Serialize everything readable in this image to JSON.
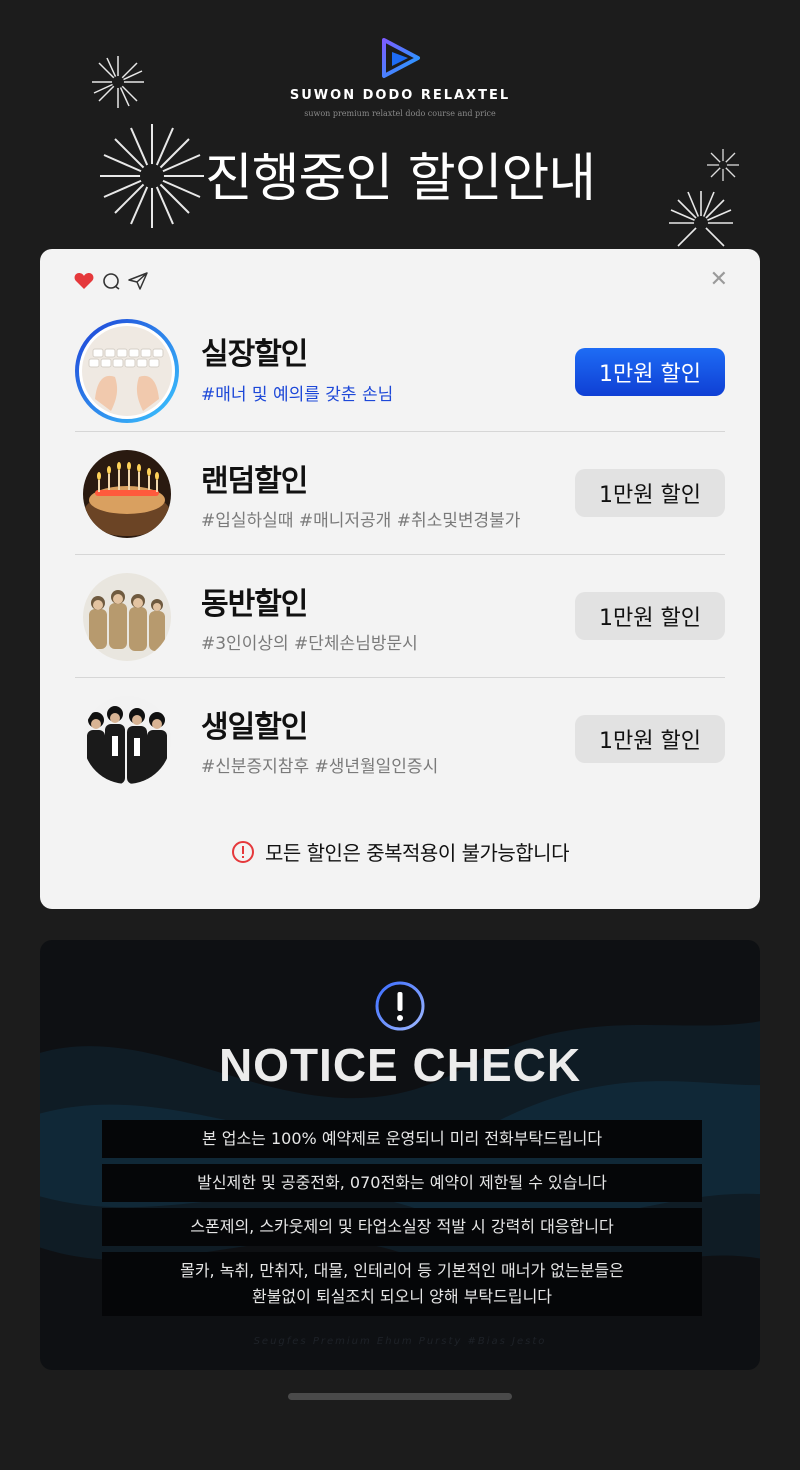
{
  "brand": {
    "name": "SUWON DODO RELAXTEL",
    "subtitle": "suwon premium relaxtel dodo course and price"
  },
  "headline": "진행중인 할인안내",
  "discounts": [
    {
      "title": "실장할인",
      "tags": "#매너 및 예의를 갖춘 손님",
      "badge": "1만원 할인",
      "active": true,
      "image": "keyboard-hands"
    },
    {
      "title": "랜덤할인",
      "tags": "#입실하실때 #매니저공개 #취소및변경불가",
      "badge": "1만원 할인",
      "active": false,
      "image": "birthday-cake-candles"
    },
    {
      "title": "동반할인",
      "tags": "#3인이상의 #단체손님방문시",
      "badge": "1만원 할인",
      "active": false,
      "image": "group-of-soldiers"
    },
    {
      "title": "생일할인",
      "tags": "#신분증지참후 #생년월일인증시",
      "badge": "1만원 할인",
      "active": false,
      "image": "group-in-suits"
    }
  ],
  "warning": "모든 할인은 중복적용이 불가능합니다",
  "notice": {
    "title": "NOTICE CHECK",
    "lines": [
      "본 업소는 100% 예약제로 운영되니 미리 전화부탁드립니다",
      "발신제한 및 공중전화, 070전화는 예약이 제한될 수 있습니다",
      "스폰제의, 스카웃제의 및 타업소실장 적발 시 강력히 대응합니다",
      "몰카, 녹취, 만취자, 대물, 인테리어 등 기본적인 매너가 없는분들은",
      "환불없이 퇴실조치 되오니 양해 부탁드립니다"
    ],
    "watermark": "Seugfes Premium Ehum Pursty #Bias Jesto"
  },
  "colors": {
    "accent": "#1e6cf5",
    "tag_blue": "#1d48d8",
    "heart": "#e5383b",
    "background": "#1c1c1c"
  },
  "icons": [
    "play-logo-icon",
    "heart-icon",
    "comment-icon",
    "send-icon",
    "close-icon",
    "alert-icon",
    "exclamation-icon"
  ]
}
